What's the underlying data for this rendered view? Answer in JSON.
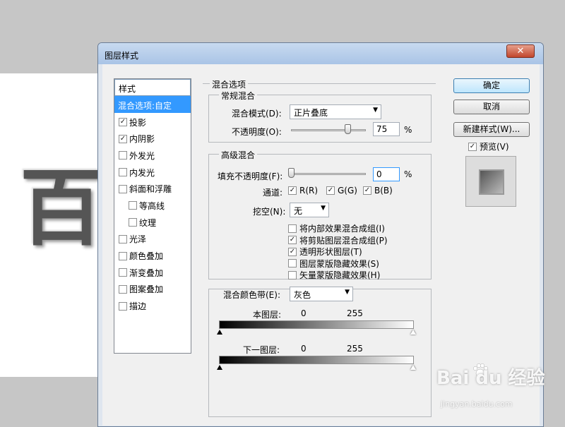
{
  "canvas": {
    "glyph": "百"
  },
  "dialog": {
    "title": "图层样式",
    "close_label": "✕",
    "styles_panel": {
      "header": "样式",
      "items": [
        {
          "label": "混合选项:自定",
          "selected": true,
          "checkbox": false
        },
        {
          "label": "投影",
          "checked": true
        },
        {
          "label": "内阴影",
          "checked": true
        },
        {
          "label": "外发光",
          "checked": false
        },
        {
          "label": "内发光",
          "checked": false
        },
        {
          "label": "斜面和浮雕",
          "checked": false
        },
        {
          "label": "等高线",
          "checked": false,
          "indent": true
        },
        {
          "label": "纹理",
          "checked": false,
          "indent": true
        },
        {
          "label": "光泽",
          "checked": false
        },
        {
          "label": "颜色叠加",
          "checked": false
        },
        {
          "label": "渐变叠加",
          "checked": false
        },
        {
          "label": "图案叠加",
          "checked": false
        },
        {
          "label": "描边",
          "checked": false
        }
      ]
    },
    "blend_options": {
      "title": "混合选项",
      "general": {
        "title": "常规混合",
        "mode_label": "混合模式(D):",
        "mode_value": "正片叠底",
        "opacity_label": "不透明度(O):",
        "opacity_value": "75",
        "unit": "%"
      },
      "advanced": {
        "title": "高级混合",
        "fill_label": "填充不透明度(F):",
        "fill_value": "0",
        "unit": "%",
        "channels_label": "通道:",
        "channels": [
          "R(R)",
          "G(G)",
          "B(B)"
        ],
        "knockout_label": "挖空(N):",
        "knockout_value": "无",
        "options": [
          {
            "label": "将内部效果混合成组(I)",
            "checked": false
          },
          {
            "label": "将剪贴图层混合成组(P)",
            "checked": true
          },
          {
            "label": "透明形状图层(T)",
            "checked": true
          },
          {
            "label": "图层蒙版隐藏效果(S)",
            "checked": false
          },
          {
            "label": "矢量蒙版隐藏效果(H)",
            "checked": false
          }
        ]
      },
      "blend_if": {
        "label": "混合颜色带(E):",
        "value": "灰色",
        "this_layer_label": "本图层:",
        "underlying_label": "下一图层:",
        "this_layer_low": "0",
        "this_layer_high": "255",
        "underlying_low": "0",
        "underlying_high": "255"
      }
    },
    "buttons": {
      "ok": "确定",
      "cancel": "取消",
      "new_style": "新建样式(W)...",
      "preview_label": "预览(V)"
    }
  },
  "watermark": {
    "text": "Bai du 经验",
    "sub": "jingyan.baidu.com"
  }
}
